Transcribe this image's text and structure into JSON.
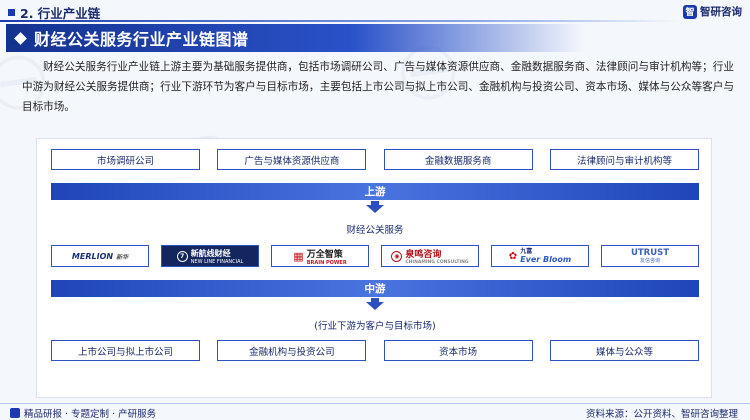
{
  "header": {
    "section_label": "2. 行业产业链",
    "logo_text": "智研咨询"
  },
  "title": "财经公关服务行业产业链图谱",
  "intro": "财经公关服务行业产业链上游主要为基础服务提供商，包括市场调研公司、广告与媒体资源供应商、金融数据服务商、法律顾问与审计机构等；行业中游为财经公关服务提供商；行业下游环节为客户与目标市场，主要包括上市公司与拟上市公司、金融机构与投资公司、资本市场、媒体与公众等客户与目标市场。",
  "chain": {
    "upstream_items": [
      "市场调研公司",
      "广告与媒体资源供应商",
      "金融数据服务商",
      "法律顾问与审计机构等"
    ],
    "upstream_band": "上游",
    "midstream_label": "财经公关服务",
    "midstream_logos": [
      {
        "name": "MERLION",
        "sub": "新华"
      },
      {
        "name": "新航线财经",
        "sub": "NEW LINE FINANCIAL"
      },
      {
        "name": "万全智策",
        "sub": "BRAIN POWER"
      },
      {
        "name": "泉鸣咨询",
        "sub": "CHINAMING CONSULTING"
      },
      {
        "name": "九富",
        "sub": "Ever Bloom"
      },
      {
        "name": "UTRUST",
        "sub": "友信咨询"
      }
    ],
    "midstream_band": "中游",
    "downstream_label": "(行业下游为客户与目标市场)",
    "downstream_items": [
      "上市公司与拟上市公司",
      "金融机构与投资公司",
      "资本市场",
      "媒体与公众等"
    ]
  },
  "footer": {
    "left": "精品研报 · 专题定制 · 产研服务",
    "source": "资料来源：公开资料、智研咨询整理"
  },
  "colors": {
    "brand": "#1a3bb0",
    "band": "#2a52c9"
  }
}
